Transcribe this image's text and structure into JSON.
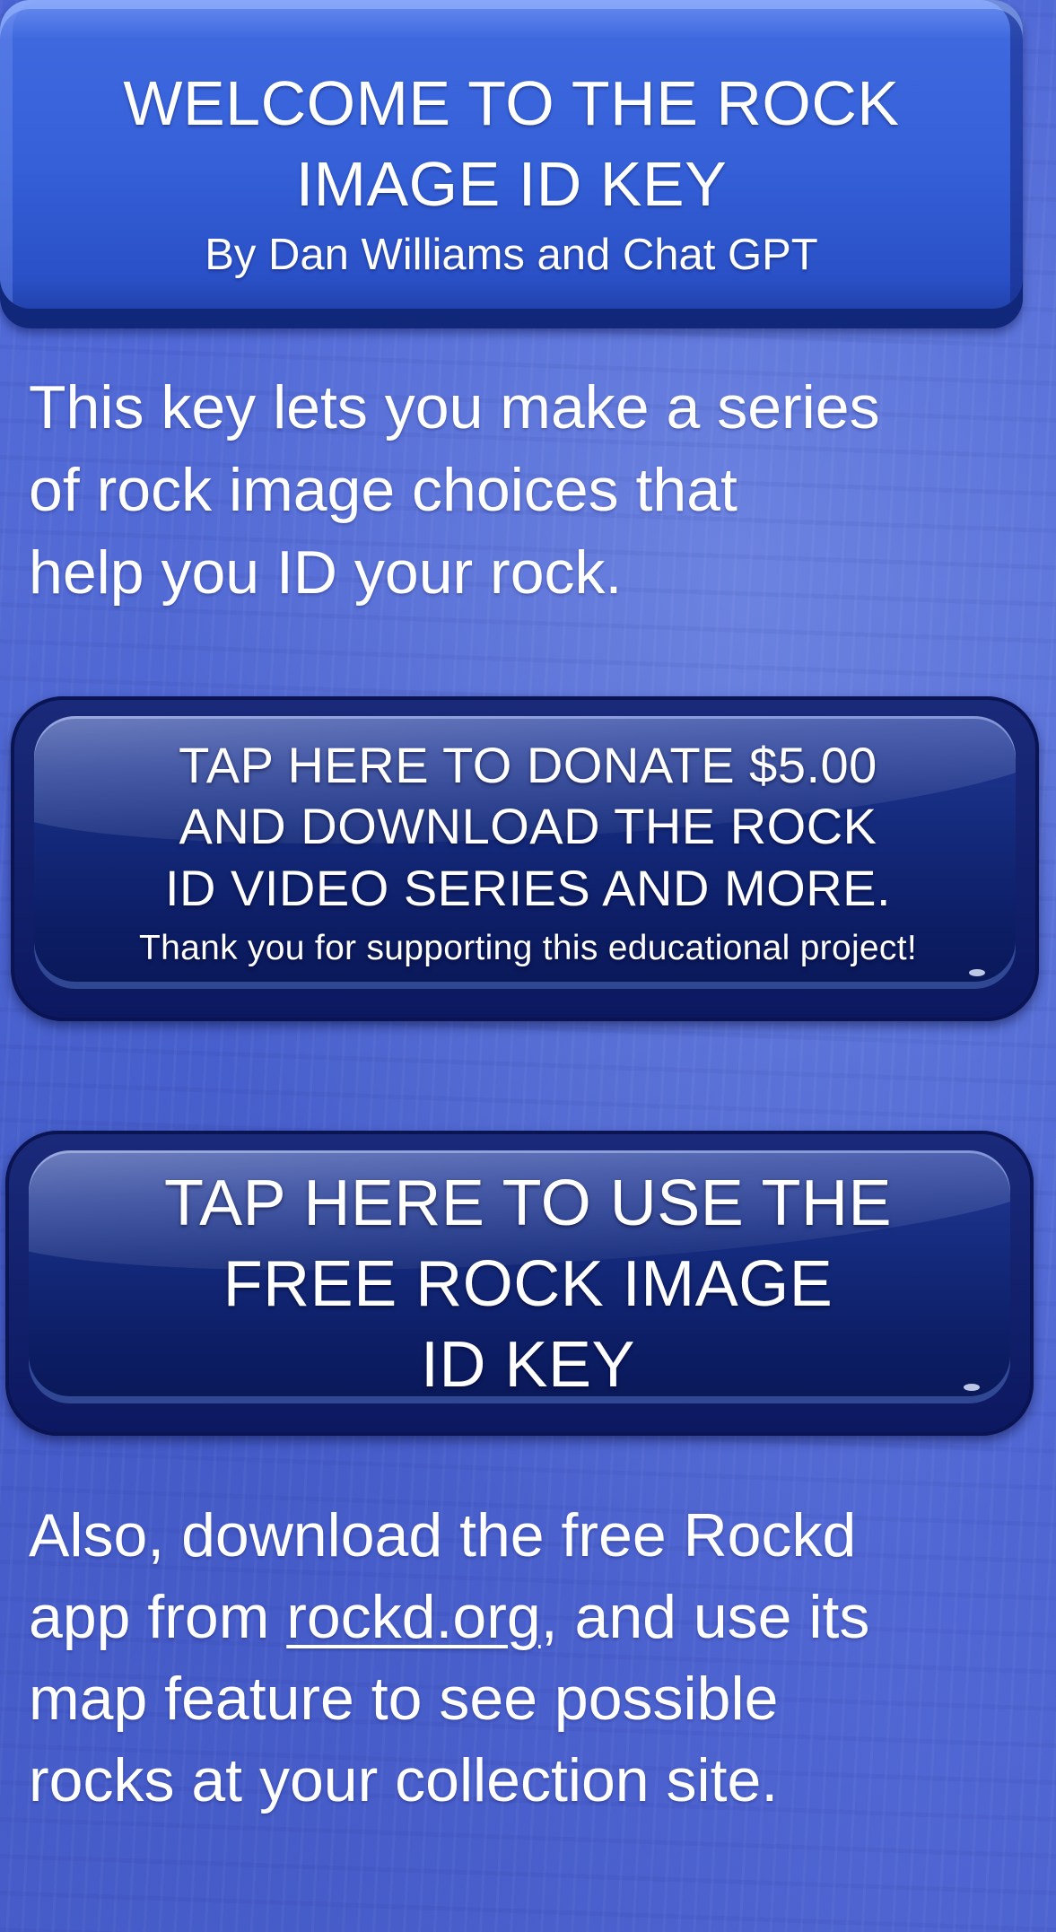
{
  "header": {
    "title_line1": "WELCOME TO THE ROCK",
    "title_line2": "IMAGE ID KEY",
    "subtitle": "By Dan Williams and Chat GPT"
  },
  "intro": {
    "line1": "This key lets you make a series",
    "line2": "of rock image choices that",
    "line3": "help you ID your rock."
  },
  "donate_button": {
    "line1": "TAP HERE TO DONATE $5.00",
    "line2": "AND DOWNLOAD THE ROCK",
    "line3": "ID VIDEO SERIES AND MORE.",
    "thanks": "Thank you for supporting this educational project!"
  },
  "free_key_button": {
    "line1": "TAP HERE TO USE THE",
    "line2": "FREE ROCK IMAGE",
    "line3": "ID KEY"
  },
  "footer": {
    "line1": "Also, download the free Rockd",
    "line2_before": "app from ",
    "link_text": "rockd.org",
    "line2_after": ", and use its",
    "line3": "map feature to see possible",
    "line4": "rocks at your collection site."
  },
  "colors": {
    "background": "#4a64d4",
    "header_banner": "#3560d8",
    "button_dark": "#0d1e66",
    "text": "#ffffff"
  }
}
